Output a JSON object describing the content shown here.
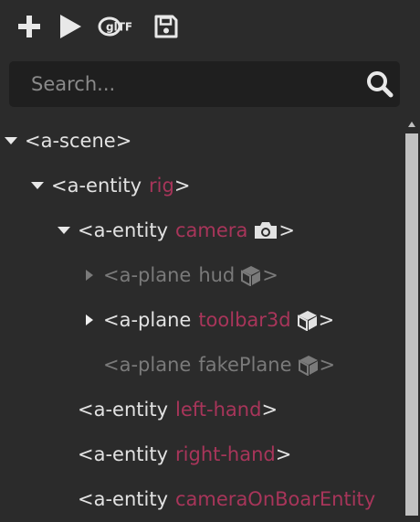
{
  "toolbar": {
    "add_icon": "plus-icon",
    "play_icon": "play-icon",
    "gltf_label": "glTF",
    "save_icon": "save-icon"
  },
  "search": {
    "placeholder": "Search...",
    "value": ""
  },
  "tree": [
    {
      "tag_open": "<a-scene",
      "name": "",
      "close": ">",
      "expanded": true,
      "state": "normal"
    },
    {
      "tag_open": "<a-entity",
      "name": "rig",
      "close": ">",
      "expanded": true,
      "state": "normal"
    },
    {
      "tag_open": "<a-entity",
      "name": "camera",
      "close": ">",
      "expanded": true,
      "state": "normal",
      "icon": "camera-icon"
    },
    {
      "tag_open": "<a-plane",
      "name": "hud",
      "close": ">",
      "expanded": false,
      "state": "dim",
      "icon": "cube-icon"
    },
    {
      "tag_open": "<a-plane",
      "name": "toolbar3d",
      "close": ">",
      "expanded": false,
      "state": "normal",
      "icon": "cube-icon"
    },
    {
      "tag_open": "<a-plane",
      "name": "fakePlane",
      "close": ">",
      "expanded": null,
      "state": "dim",
      "icon": "cube-icon"
    },
    {
      "tag_open": "<a-entity",
      "name": "left-hand",
      "close": ">",
      "expanded": null,
      "state": "normal"
    },
    {
      "tag_open": "<a-entity",
      "name": "right-hand",
      "close": ">",
      "expanded": null,
      "state": "normal"
    },
    {
      "tag_open": "<a-entity",
      "name": "cameraOnBoarEntity",
      "close": "",
      "expanded": null,
      "state": "normal"
    }
  ],
  "colors": {
    "background": "#2b2b2b",
    "entity_name": "#a8355a",
    "text": "#e2e2e2",
    "dim_text": "#7a7a7a"
  }
}
